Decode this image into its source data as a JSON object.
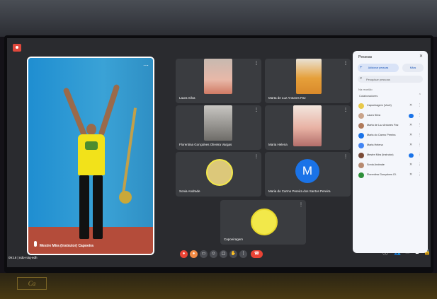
{
  "main_video": {
    "name": "Mestre Mira (Instrutor) Capoeira"
  },
  "grid": [
    {
      "name": "Laura Silva"
    },
    {
      "name": "Marta de Luz Antunes Paz"
    },
    {
      "name": "Florentina Gonçalves Oliveira Vargas"
    },
    {
      "name": "Maria Helena"
    },
    {
      "name": "Sonia Andrade"
    },
    {
      "name": "Maria do Carmo Pereira dos Santos Pereira",
      "avatar_letter": "M"
    },
    {
      "name": "Capoeiragem"
    }
  ],
  "footer": {
    "time": "09:18",
    "separator": "|",
    "meeting_code": "ndo-roiq-edh"
  },
  "panel": {
    "title": "Pessoas",
    "close": "✕",
    "add_button": "Adicionar pessoas",
    "raise_button": "Mãos",
    "search_placeholder": "Pesquisar pessoas",
    "section_label": "Na reunião",
    "collab_label": "Colaboradores",
    "collab_count": "8",
    "participants": [
      {
        "name": "Capoeiragem (Você)"
      },
      {
        "name": "Laura Silva"
      },
      {
        "name": "Marta de Luz Antunes Paz"
      },
      {
        "name": "Maria do Carmo Pereira"
      },
      {
        "name": "Maria Helena"
      },
      {
        "name": "Mestre Mira (Instrutor)"
      },
      {
        "name": "Sonia Andrade"
      },
      {
        "name": "Florentina Gonçalves Ol."
      }
    ]
  },
  "colors": {
    "record": "#e0483c",
    "meet_blue": "#1a73e8",
    "hangup": "#ea4335"
  }
}
